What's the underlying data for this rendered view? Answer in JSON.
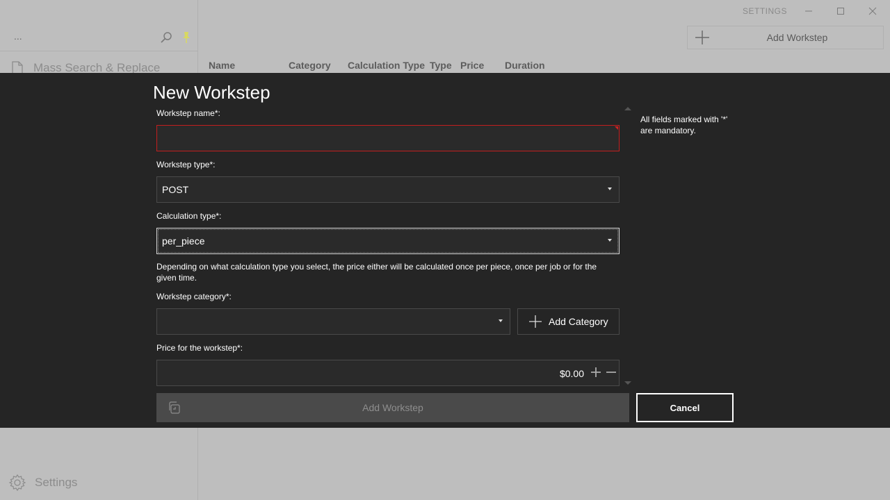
{
  "window": {
    "title": "SETTINGS",
    "minimize_icon": "minimize-icon",
    "maximize_icon": "maximize-icon",
    "close_icon": "close-icon"
  },
  "sidebar": {
    "search_value": "...",
    "items": [
      {
        "label": "Mass Search & Replace",
        "icon": "document-icon"
      }
    ],
    "settings_label": "Settings"
  },
  "toolbar": {
    "add_workstep_label": "Add Workstep"
  },
  "table": {
    "columns": [
      "Name",
      "Category",
      "Calculation Type",
      "Type",
      "Price",
      "Duration"
    ]
  },
  "dialog": {
    "title": "New Workstep",
    "mandatory_note": "All fields marked with '*' are mandatory.",
    "name": {
      "label": "Workstep name*:",
      "value": ""
    },
    "type": {
      "label": "Workstep type*:",
      "value": "POST"
    },
    "calc": {
      "label": "Calculation type*:",
      "value": "per_piece"
    },
    "helper_text": "Depending on what calculation type you select, the price either will be calculated once per piece, once per job or for the given time.",
    "category": {
      "label": "Workstep category*:",
      "value": "",
      "add_label": "Add Category"
    },
    "price": {
      "label": "Price for the workstep*:",
      "value": "$0.00"
    },
    "submit_label": "Add Workstep",
    "cancel_label": "Cancel"
  }
}
